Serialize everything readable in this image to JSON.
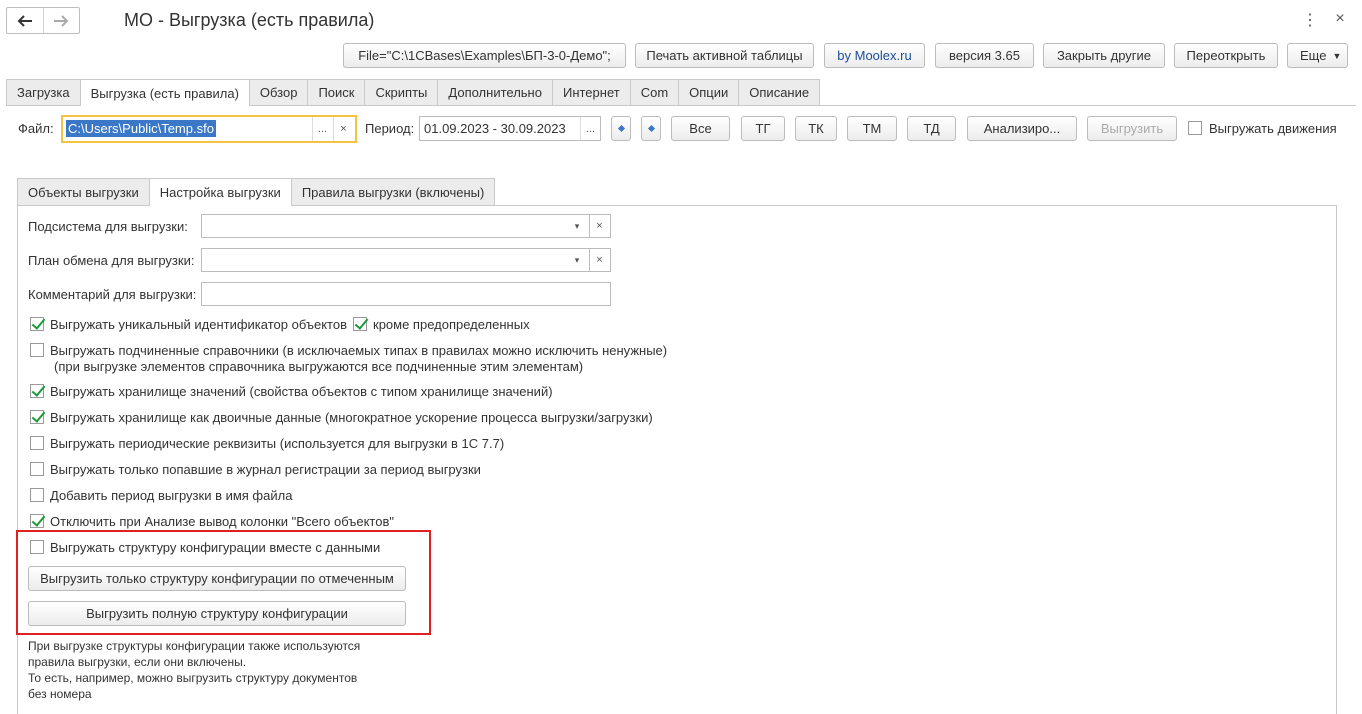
{
  "window": {
    "title": "МО - Выгрузка (есть правила)",
    "back_icon": "arrow-left-icon",
    "forward_icon": "arrow-right-icon",
    "more_glyph": "⋮",
    "close_glyph": "×"
  },
  "toolbar": {
    "file_button": "File=\"C:\\1CBases\\Examples\\БП-3-0-Демо\";",
    "print_button": "Печать активной таблицы",
    "moolex_button": "by Moolex.ru",
    "version_button": "версия 3.65",
    "close_others_button": "Закрыть другие",
    "reopen_button": "Переоткрыть",
    "more_button": "Еще"
  },
  "tabs": [
    {
      "label": "Загрузка"
    },
    {
      "label": "Выгрузка (есть правила)",
      "active": true
    },
    {
      "label": "Обзор"
    },
    {
      "label": "Поиск"
    },
    {
      "label": "Скрипты"
    },
    {
      "label": "Дополнительно"
    },
    {
      "label": "Интернет"
    },
    {
      "label": "Com"
    },
    {
      "label": "Опции"
    },
    {
      "label": "Описание"
    }
  ],
  "form": {
    "file_label": "Файл:",
    "file_value": "C:\\Users\\Public\\Temp.sfo",
    "period_label": "Период:",
    "period_value": "01.09.2023 - 30.09.2023",
    "ellipsis": "...",
    "clear_glyph": "×",
    "btn_all": "Все",
    "btn_tg": "ТГ",
    "btn_tk": "ТК",
    "btn_tm": "ТМ",
    "btn_td": "ТД",
    "btn_analyze": "Анализиро...",
    "btn_export": "Выгрузить",
    "export_movements_label": "Выгружать движения",
    "export_movements_checked": false
  },
  "inner_tabs": [
    {
      "label": "Объекты выгрузки"
    },
    {
      "label": "Настройка выгрузки",
      "active": true
    },
    {
      "label": "Правила выгрузки (включены)"
    }
  ],
  "settings": {
    "subsystem_label": "Подсистема для выгрузки:",
    "subsystem_value": "",
    "exchange_plan_label": "План обмена для выгрузки:",
    "exchange_plan_value": "",
    "comment_label": "Комментарий для выгрузки:",
    "comment_value": "",
    "dropdown_glyph": "▾",
    "clear_glyph": "×",
    "checkboxes": [
      {
        "label": "Выгружать уникальный идентификатор объектов",
        "checked": true
      },
      {
        "label": "кроме предопределенных",
        "checked": true
      },
      {
        "label": "Выгружать подчиненные справочники (в исключаемых типах в правилах можно исключить ненужные)",
        "checked": false
      },
      {
        "label": "Выгружать хранилище значений (свойства объектов с типом хранилище значений)",
        "checked": true
      },
      {
        "label": "Выгружать хранилище как двоичные данные (многократное ускорение процесса выгрузки/загрузки)",
        "checked": true
      },
      {
        "label": "Выгружать периодические реквизиты (используется для выгрузки в 1С 7.7)",
        "checked": false
      },
      {
        "label": "Выгружать только попавшие в журнал регистрации за период выгрузки",
        "checked": false
      },
      {
        "label": "Добавить период выгрузки в имя файла",
        "checked": false
      },
      {
        "label": "Отключить при Анализе вывод колонки \"Всего объектов\"",
        "checked": true
      },
      {
        "label": "Выгружать структуру конфигурации вместе с данными",
        "checked": false
      }
    ],
    "subordinate_note": "(при выгрузке элементов справочника выгружаются все подчиненные этим элементам)",
    "export_marked_structure_button": "Выгрузить только структуру конфигурации по отмеченным",
    "export_full_structure_button": "Выгрузить полную структуру конфигурации",
    "note_lines": [
      "При выгрузке структуры конфигурации также используются",
      "правила выгрузки, если они включены.",
      "То есть, например, можно выгрузить структуру документов",
      "без номера"
    ]
  },
  "colors": {
    "highlight_border": "#e02020",
    "file_field_border": "#f5c342",
    "selection": "#3a77c7",
    "check": "#1a9b3a"
  }
}
